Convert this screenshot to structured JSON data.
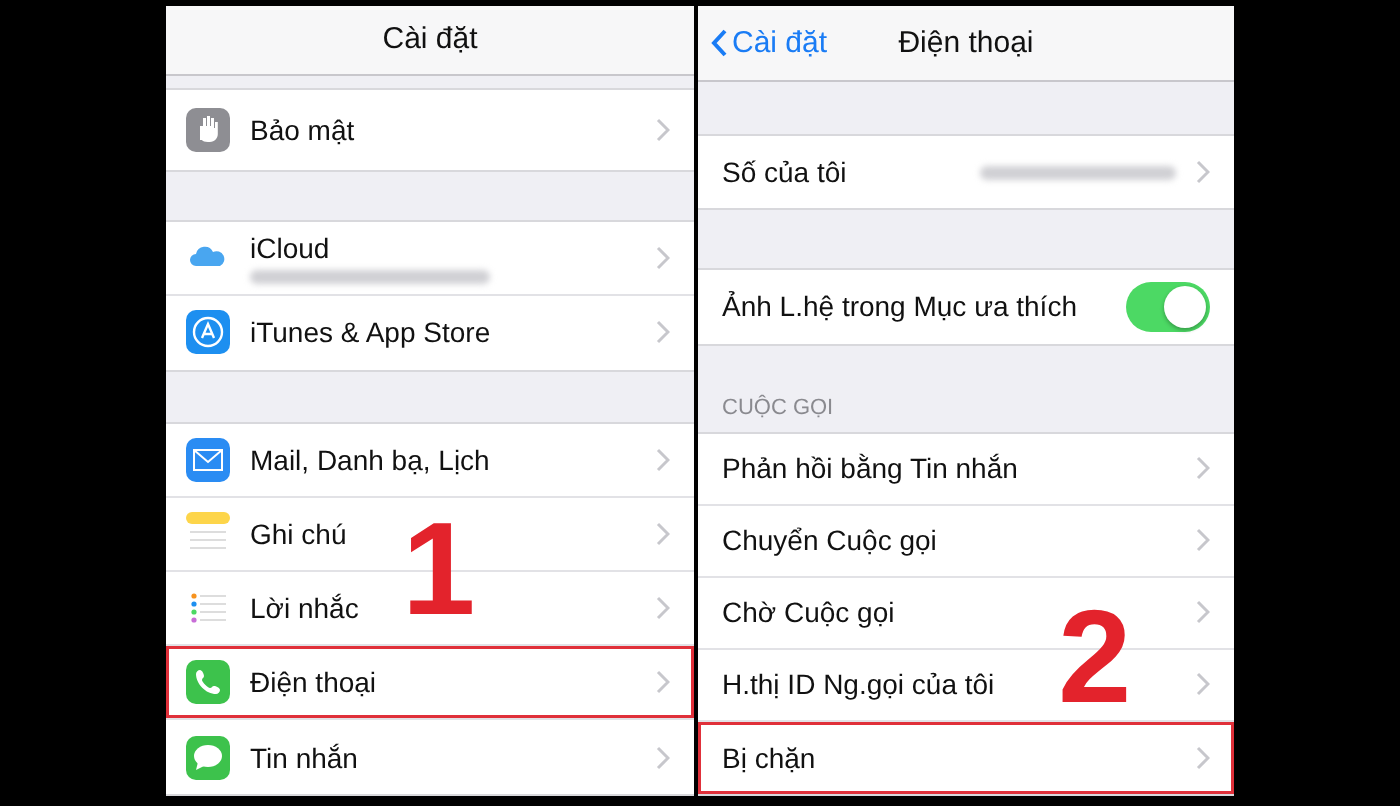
{
  "panels": [
    {
      "title": "Cài đặt",
      "annotation": "1",
      "groups": [
        {
          "rows": [
            {
              "kind": "link",
              "label": "Bảo mật",
              "highlighted": false
            }
          ]
        },
        {
          "rows": [
            {
              "kind": "link",
              "label": "iCloud",
              "blurred_detail": true,
              "highlighted": false
            },
            {
              "kind": "link",
              "label": "iTunes & App Store",
              "highlighted": false
            }
          ]
        },
        {
          "rows": [
            {
              "kind": "link",
              "label": "Mail, Danh bạ, Lịch",
              "highlighted": false
            },
            {
              "kind": "link",
              "label": "Ghi chú",
              "highlighted": false
            },
            {
              "kind": "link",
              "label": "Lời nhắc",
              "highlighted": false
            },
            {
              "kind": "link",
              "label": "Điện thoại",
              "highlighted": true
            },
            {
              "kind": "link",
              "label": "Tin nhắn",
              "highlighted": false
            }
          ]
        }
      ]
    },
    {
      "back": "Cài đặt",
      "title": "Điện thoại",
      "annotation": "2",
      "groups": [
        {
          "rows": [
            {
              "kind": "link",
              "label": "Số của tôi",
              "blurred_detail": true,
              "highlighted": false
            }
          ]
        },
        {
          "rows": [
            {
              "kind": "toggle",
              "label": "Ảnh L.hệ trong Mục ưa thích",
              "on": true,
              "highlighted": false
            }
          ]
        },
        {
          "header": "CUỘC GỌI",
          "rows": [
            {
              "kind": "link",
              "label": "Phản hồi bằng Tin nhắn",
              "highlighted": false
            },
            {
              "kind": "link",
              "label": "Chuyển Cuộc gọi",
              "highlighted": false
            },
            {
              "kind": "link",
              "label": "Chờ Cuộc gọi",
              "highlighted": false
            },
            {
              "kind": "link",
              "label": "H.thị ID Ng.gọi của tôi",
              "highlighted": false
            },
            {
              "kind": "link",
              "label": "Bị chặn",
              "highlighted": true
            }
          ]
        }
      ]
    }
  ]
}
